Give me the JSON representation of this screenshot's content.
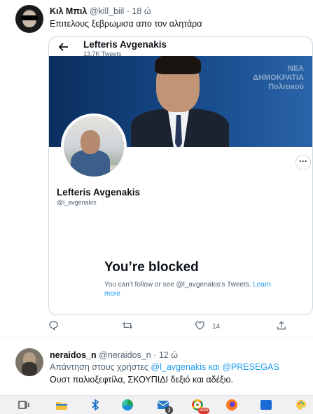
{
  "tweet1": {
    "display_name": "Κιλ Μπιλ",
    "handle": "@kill_biil",
    "separator": "·",
    "time": "18 ώ",
    "text": "Επιτελους ξεβρωμισα απο τον αλητάρα",
    "actions": {
      "like_count": "14"
    }
  },
  "embedded_profile": {
    "back_icon": "arrow-left-icon",
    "name": "Lefteris Avgenakis",
    "tweets_count": "13.7K Tweets",
    "banner_text": "ΝΕΑ ΔΗΜΟΚΡΑΤΙΑ\nΠολιτικού",
    "more_label": "···",
    "handle": "@l_avgenakis",
    "blocked_title": "You’re blocked",
    "blocked_desc": "You can’t follow or see @l_avgenakis’s Tweets.",
    "learn_more": "Learn more"
  },
  "tweet2": {
    "display_name": "neraidos_n",
    "handle": "@neraidos_n",
    "separator": "·",
    "time": "12 ώ",
    "reply_prefix": "Απάντηση στους χρήστες",
    "reply_mention1": "@l_avgenakis",
    "reply_and": "και",
    "reply_mention2": "@PRESEGAS",
    "text": "Ουστ παλιοξεφτίλα, ΣΚΟΥΠΙΔΙ δεξιό και αδέξιο."
  },
  "taskbar": {
    "mail_badge": "3",
    "chrome_badge": "arda"
  }
}
